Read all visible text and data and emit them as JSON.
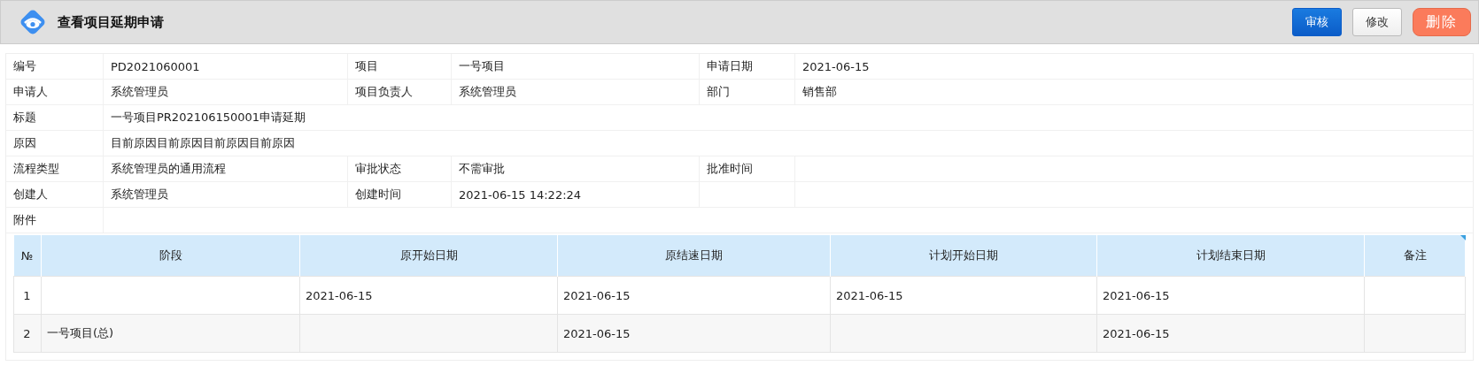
{
  "header": {
    "title": "查看项目延期申请",
    "buttons": [
      {
        "label": "审核",
        "kind": "primary"
      },
      {
        "label": "修改",
        "kind": "default"
      },
      {
        "label": "删除",
        "kind": "danger"
      }
    ]
  },
  "form": {
    "rows": [
      {
        "kind": "grid",
        "fields": [
          {
            "label": "编号",
            "value": "PD2021060001"
          },
          {
            "label": "项目",
            "value": "一号项目"
          },
          {
            "label": "申请日期",
            "value": "2021-06-15"
          }
        ]
      },
      {
        "kind": "grid",
        "fields": [
          {
            "label": "申请人",
            "value": "系统管理员"
          },
          {
            "label": "项目负责人",
            "value": "系统管理员"
          },
          {
            "label": "部门",
            "value": "销售部"
          }
        ]
      },
      {
        "kind": "wide",
        "fields": [
          {
            "label": "标题",
            "value": "一号项目PR202106150001申请延期"
          }
        ]
      },
      {
        "kind": "wide",
        "fields": [
          {
            "label": "原因",
            "value": "目前原因目前原因目前原因目前原因"
          }
        ]
      },
      {
        "kind": "grid",
        "fields": [
          {
            "label": "流程类型",
            "value": "系统管理员的通用流程"
          },
          {
            "label": "审批状态",
            "value": "不需审批"
          },
          {
            "label": "批准时间"
          }
        ]
      },
      {
        "kind": "grid",
        "fields": [
          {
            "label": "创建人",
            "value": "系统管理员"
          },
          {
            "label": "创建时间",
            "value": "2021-06-15 14:22:24"
          }
        ]
      },
      {
        "kind": "wide",
        "fields": [
          {
            "label": "附件"
          }
        ]
      }
    ]
  },
  "table": {
    "columns": [
      "№",
      "阶段",
      "原开始日期",
      "原结速日期",
      "计划开始日期",
      "计划结束日期",
      "备注"
    ],
    "rows": [
      {
        "cells": [
          "1",
          null,
          "2021-06-15",
          "2021-06-15",
          "2021-06-15",
          "2021-06-15",
          null
        ]
      },
      {
        "cells": [
          "2",
          "一号项目(总)",
          null,
          "2021-06-15",
          null,
          "2021-06-15",
          null
        ]
      }
    ]
  }
}
